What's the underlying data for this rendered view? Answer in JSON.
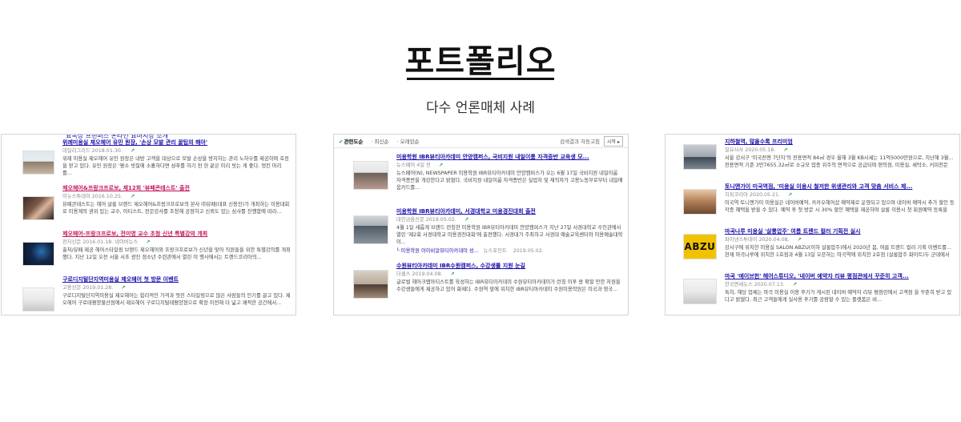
{
  "page": {
    "title": "포트폴리오",
    "subtitle": "다수 언론매체 사례"
  },
  "panel1": {
    "clipped_top": "요목상 프랜퍼스 온라인 요마시장 소개",
    "items": [
      {
        "thumb": "office-photo",
        "headline": "위례미용실 제오헤어 유민 원장, '손상 모발 관리 꿀팁의 해아'",
        "source": "데일리그리드",
        "date": "2018.01.30.",
        "snippet": "위례 미용실 제오헤어 유민 원장은 내방 고객을 대상으로 모발 손상을 방지하는 관리 노하우를 제공하며 호응을 얻고 있다. 유민 원장은 '평소 빗질에 소홀하다면 샴푸를 하기 전 헌 끝은 미리 빗는 게 좋다. 엉킨 머리를..."
      },
      {
        "thumb": "makeup-photo",
        "headline": "제오헤어&프랑크프로보, 제12회 '뷰페콘테스트' 출전",
        "source": "이뉴스투데이",
        "date": "2016.10.25.",
        "snippet": "뷰페콘테스트는 헤어 살롱 브랜드 제오헤어&프랑크프로보의 본사 ㈜뷰페(대표 신용진)가 개최하는 미용대회로 미용계의 권위 있는 교수, 아티스트, 전문강사를 초청해 공정하고 신뢰도 있는 심사를 진행함에 따라..."
      },
      {
        "thumb": "lecture-photo",
        "headline": "제오헤어-프랑크프로보, 전미영 교수 초청 신년 특별강의 개최",
        "source": "전자신문",
        "date": "2016.01.18.",
        "source2": "네이버뉴스",
        "snippet": "출처/뷰페 제공 헤어스타일링 브랜드 제오헤어와 프랑크프로보가 신년을 맞아 직원들을 위한 특별강의를 개최했다. 지난 12일 오전 서울 서초 광진 정소년 수련관에서 열린 이 행사에서는 트렌드코리아의..."
      },
      {
        "thumb": "interior-photo",
        "headline": "구로디지털단지역미용실 제오헤어 첫 방문 이벤트",
        "source": "고용신문",
        "date": "2019.01.28.",
        "snippet": "구로디지털단지역미용실 제오헤어는 합리적인 가격과 멋진 스타일링으로 많은 사람들의 인기를 끌고 있다. 제오헤어 구로태평양물산점에서 제오헤어 구로디지털태평양점으로 확장 이전해 더 넓고 쾌적한 공간에서..."
      }
    ]
  },
  "panel2": {
    "toolbar": {
      "opt1": "관련도순",
      "opt2": "최신순",
      "opt3": "오래된순",
      "right_label": "검색결과 자동고침",
      "right_button": "시작"
    },
    "items": [
      {
        "thumb": "group-photo",
        "headline": "미용학원 IBR뷰티아카데미 안양캠퍼스, 국비지원 내일이룸 자격증반 교육생 모...",
        "source": "뉴스페어",
        "date": "4일 전",
        "snippet": "뉴스페어(N), NEWSPAPER 미용학원 IBR뷰티아카데미 안양캠퍼스가 오는 6월 17일 국비지원 내일이룸 자격증반을 개강한다고 밝혔다. 국비지원 내일이룸 자격증반은 실업자 및 재직자가 고용노동부로부터 내일배움카드를..."
      },
      {
        "thumb": "class-photo",
        "headline": "미용학원 IBR뷰티아카데미, 서경대학교 미용경진대회 출전",
        "source": "대한금융신문",
        "date": "2019.05.02.",
        "snippet": "4월 1일 새롭게 브랜드 런칭한 미용학원 IBR뷰티아카데미 안양캠퍼스가 지난 27일 서경대학교 수인관에서 열린 '제2회 서경대학교 미용경진대회'에 출전했다. 서경대가 주최하고 서경대 예술교육센터와 미용예술대학이...",
        "related": "미용학원 아이비알뷰티아카데미 성...",
        "related_source": "뉴스포인트",
        "related_date": "2019.05.02."
      },
      {
        "thumb": "students-photo",
        "headline": "수원뷰티아카데미 IBR수원캠퍼스, 수강생률 지원 눈길",
        "source": "더셀스",
        "date": "2019.04.08.",
        "snippet": "글로벌 헤어크랩아티스트를 육성하는 IBR뷰티아카데미 수원뷰티아카데미가 런칭 이후 왕 확할 만한 자원을 수강생들에게 제공하고 있어 화제다. 수원역 앞에 위치한 IBR뷰티아카데미 수원미용학원은 미국과 영국..."
      }
    ]
  },
  "panel3": {
    "items": [
      {
        "thumb": "office-building-photo",
        "headline": "지하철역, 많을수록 프리미엄",
        "source": "일요서사",
        "date": "2020.05.18.",
        "snippet": "서울 강서구 '미국전엔 7단지'의 전용면적 84㎡ 경우 올해 3월 KB시세는 11억5000만원으로, 지난해 3월... 전용면적 기준 3만7655.32㎡로 소규모 업종 위주의 면적으로 공급되며 편의점, 미용실, 세탁소, 커피전문점..."
      },
      {
        "thumb": "salon-photo",
        "headline": "토니앤가이 미국역점, '미용실 이용시 철저한 위생관리와 고객 맞춤 서비스 제...",
        "source": "지피코리아",
        "date": "2020.05.21.",
        "snippet": "미국역 토니앤가이 미용실은 네이버예약, 카카오헤어샵 예약제로 운영되고 있으며 네이버 예약시 추가 할인 등 각종 혜택을 받을 수 있다. 예약 후 첫 방문 시 30% 할인 혜택을 제공하며 살롱 이용시 첫 회원예약 등록을 한..."
      },
      {
        "thumb": "abzu-logo",
        "thumb_text": "ABZU",
        "headline": "마곡나루 미용실 '살롱압주' 여름 트렌드 컬러 기획전 실시",
        "source": "파이낸스투데이",
        "date": "2020.04.08.",
        "snippet": "강서구에 위치한 미용실 SALON ABZU(이하 살롱압주)에서 2020년 봄, 여름 트렌드 컬러 기획 이벤트를... 현재 마곡나루에 위치한 1호점과 4월 13일 오픈하는 마곡역에 위치한 2호점 (살롱압주 화이트)두 군데에서 펼사..."
      },
      {
        "thumb": "interior-photo-2",
        "headline": "마곡 '에이브헌' 헤어스튜디오, '네이버 예약자 리뷰 평점관에서 꾸준히 고객...",
        "source": "한국면세뉴스",
        "date": "2020.07.13.",
        "snippet": "특히, 해당 업체는 마곡 미용실 이용 후기가 게시된 네이버 예약자 리뷰 평점란에서 고객점 을 꾸준히 받고 있다고 밝혔다. 최근 고객들에게 실사용 후기를 공람할 수 있는 플랫폼은 비..."
      }
    ]
  }
}
